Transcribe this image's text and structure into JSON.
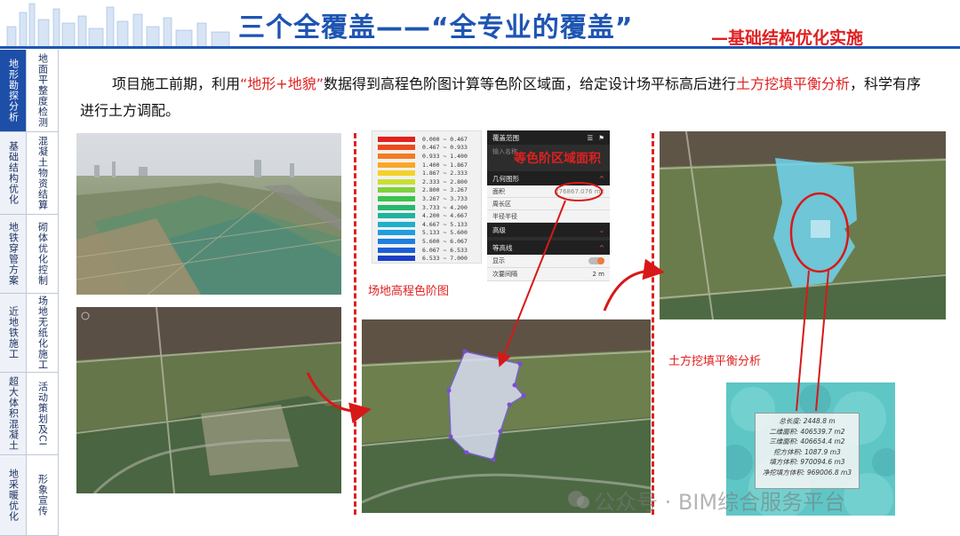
{
  "header": {
    "title": "三个全覆盖——“全专业的覆盖”",
    "subtitle": "—基础结构优化实施"
  },
  "nav": [
    {
      "category": "地形勘探分析",
      "sub": "地面平整度检测",
      "active": true
    },
    {
      "category": "基础结构优化",
      "sub": "混凝土物资结算",
      "active": false
    },
    {
      "category": "地铁穿管方案",
      "sub": "砌体优化控制",
      "active": false
    },
    {
      "category": "近地铁施工",
      "sub": "场地无纸化施工",
      "active": false
    },
    {
      "category": "超大体积混凝土",
      "sub": "活动策划及CI",
      "active": false
    },
    {
      "category": "地采暖优化",
      "sub": "形象宣传",
      "active": false
    }
  ],
  "description": {
    "part1": "项目施工前期，利用",
    "highlight1": "“地形+地貌”",
    "part2": "数据得到高程色阶图计算等色阶区域面，给定设计场平标高后进行",
    "highlight2": "土方挖填平衡分析",
    "part3": "，科学有序进行土方调配。"
  },
  "legend": {
    "caption": "场地高程色阶图",
    "items": [
      {
        "range": "0.000 ~ 0.467",
        "color": "#e3201b"
      },
      {
        "range": "0.467 ~ 0.933",
        "color": "#ee4a1c"
      },
      {
        "range": "0.933 ~ 1.400",
        "color": "#f57c1f"
      },
      {
        "range": "1.400 ~ 1.867",
        "color": "#f9a825"
      },
      {
        "range": "1.867 ~ 2.333",
        "color": "#f4d22a"
      },
      {
        "range": "2.333 ~ 2.800",
        "color": "#c7e033"
      },
      {
        "range": "2.800 ~ 3.267",
        "color": "#7fd13b"
      },
      {
        "range": "3.267 ~ 3.733",
        "color": "#3cc44a"
      },
      {
        "range": "3.733 ~ 4.200",
        "color": "#26b86b"
      },
      {
        "range": "4.200 ~ 4.667",
        "color": "#20b3a0"
      },
      {
        "range": "4.667 ~ 5.133",
        "color": "#1fb0cc"
      },
      {
        "range": "5.133 ~ 5.600",
        "color": "#1e9ee0"
      },
      {
        "range": "5.600 ~ 6.067",
        "color": "#1d7fe0"
      },
      {
        "range": "6.067 ~ 6.533",
        "color": "#1b5fd6"
      },
      {
        "range": "6.533 ~ 7.000",
        "color": "#1a3fc8"
      }
    ]
  },
  "cover_panel": {
    "title": "覆盖范围",
    "search_placeholder": "输入名称",
    "section_geometry": "几何图形",
    "area_label": "面积",
    "area_value": "276867.076 m2",
    "perimeter_label": "周长区",
    "radius_label": "半径半径",
    "section_elevation": "高级",
    "section_contour": "等高线",
    "show_label": "显示",
    "interval_label": "次要间隔",
    "interval_value": "2 m",
    "overlay_label": "等色阶区域面积"
  },
  "balance_label": "土方挖填平衡分析",
  "stats": [
    "总长度: 2448.8 m",
    "二维面积: 406539.7 m2",
    "三维面积: 406654.4 m2",
    "挖方体积: 1087.9 m3",
    "填方体积: 970094.6 m3",
    "净挖填方体积: 969006.8 m3"
  ],
  "watermark": "公众号 · BIM综合服务平台"
}
